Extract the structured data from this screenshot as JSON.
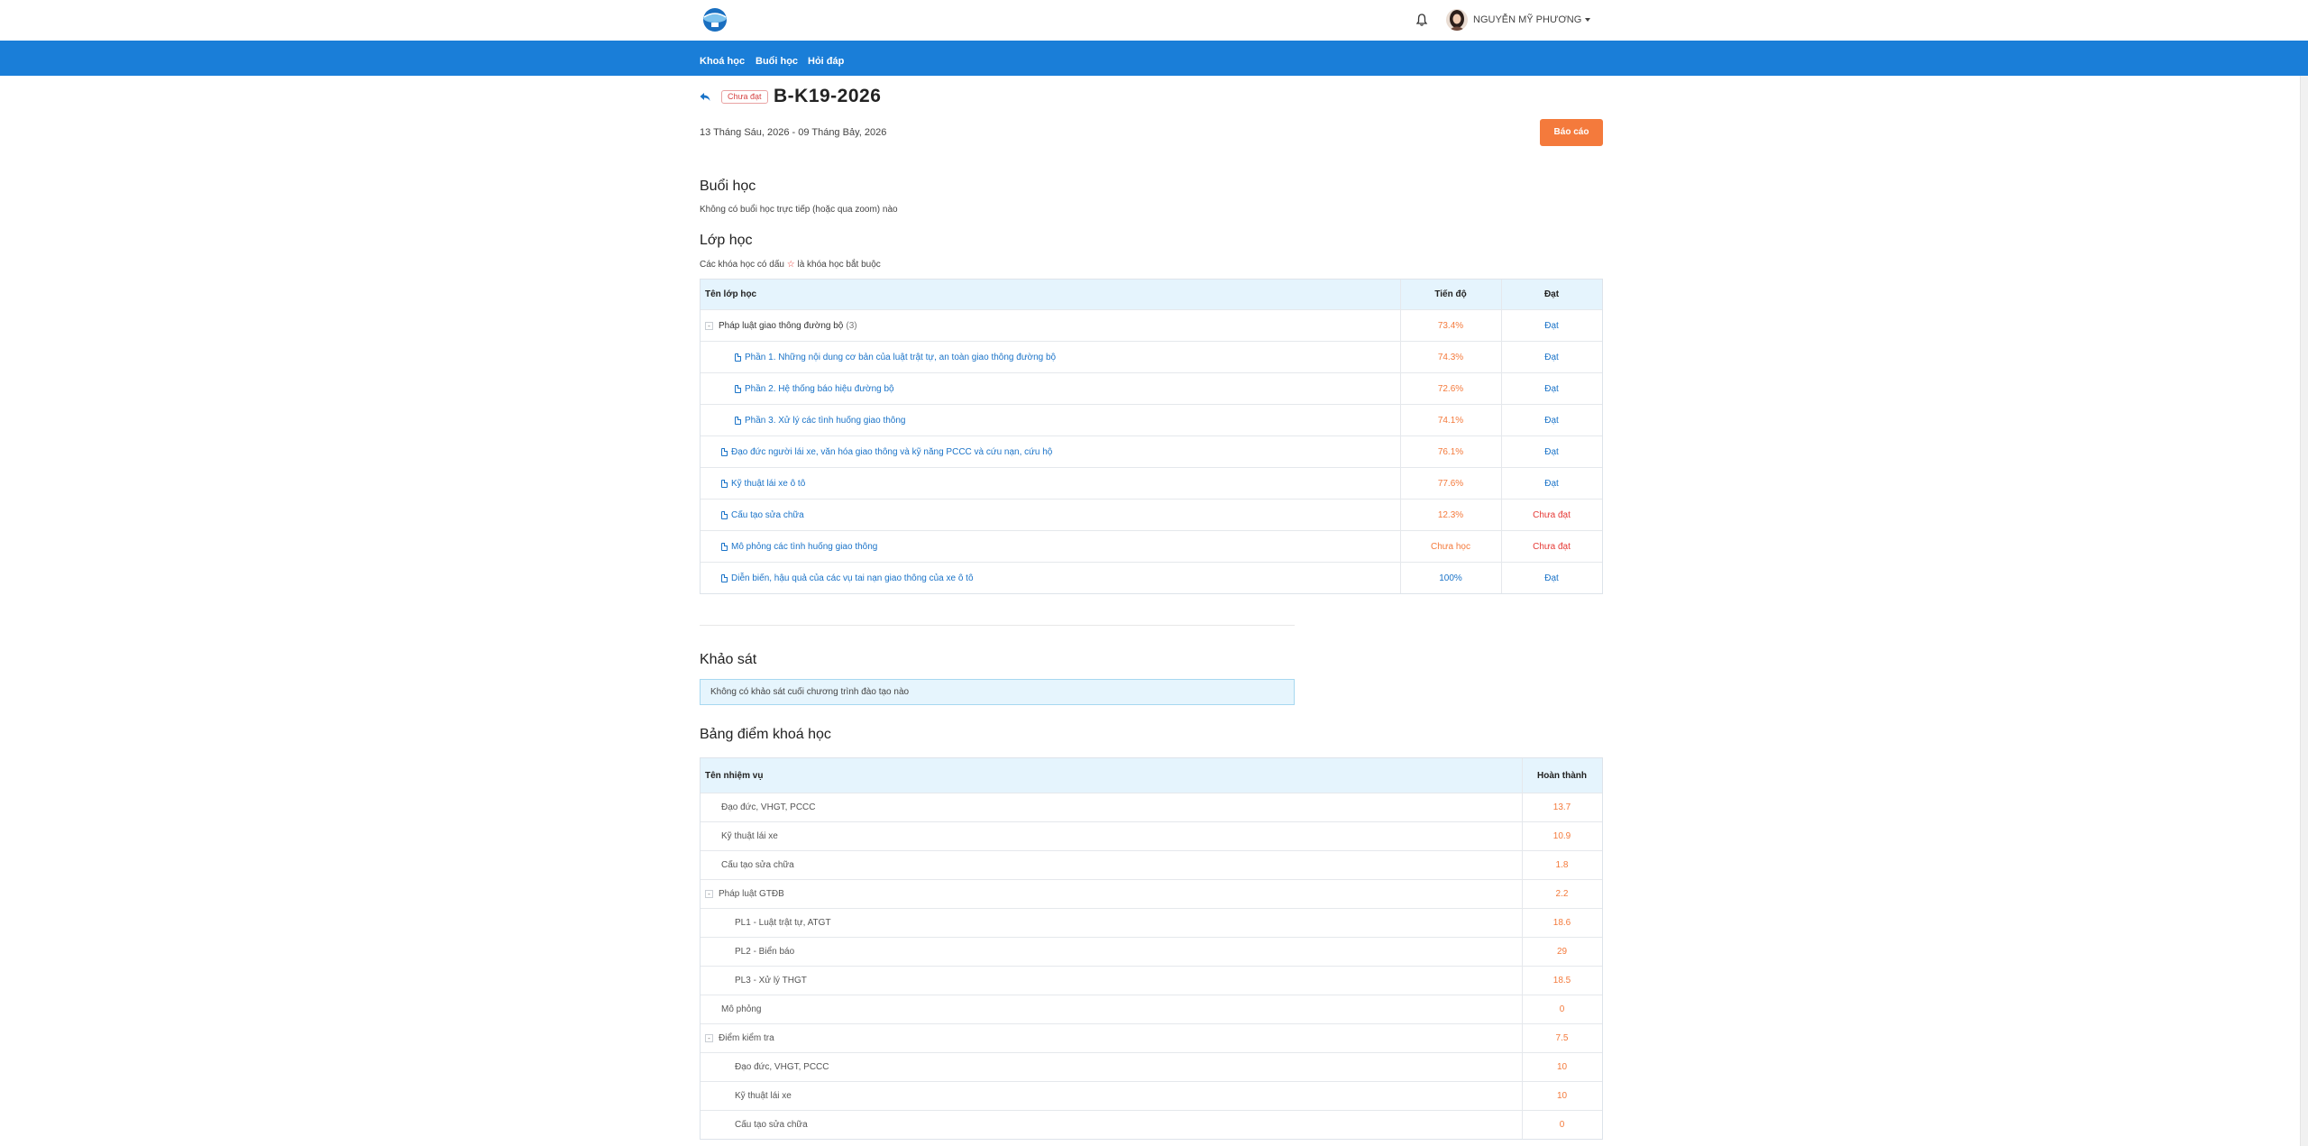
{
  "header": {
    "user_name": "NGUYỄN MỸ PHƯƠNG",
    "logo_icon": "school-logo-icon",
    "bell_icon": "bell-icon"
  },
  "nav": {
    "items": [
      "Khoá học",
      "Buổi học",
      "Hỏi đáp"
    ]
  },
  "course": {
    "status_badge": "Chưa đạt",
    "title": "B-K19-2026",
    "date_range": "13 Tháng Sáu, 2026 - 09 Tháng Bảy, 2026",
    "report_button": "Báo cáo"
  },
  "sessions": {
    "title": "Buổi học",
    "empty_text": "Không có buổi học trực tiếp (hoặc qua zoom) nào"
  },
  "classes": {
    "title": "Lớp học",
    "note_before": "Các khóa học có dấu",
    "note_star": "☆",
    "note_after": "là khóa học bắt buộc",
    "columns": [
      "Tên lớp học",
      "Tiến độ",
      "Đạt"
    ],
    "rows": [
      {
        "name": "Pháp luật giao thông đường bộ",
        "count": "(3)",
        "progress": "73.4%",
        "result": "Đạt",
        "level": 0,
        "group": true
      },
      {
        "name": "Phần 1. Những nội dung cơ bản của luật trật tự, an toàn giao thông đường bộ",
        "progress": "74.3%",
        "result": "Đạt",
        "level": 2
      },
      {
        "name": "Phần 2. Hệ thống báo hiệu đường bộ",
        "progress": "72.6%",
        "result": "Đạt",
        "level": 2
      },
      {
        "name": "Phần 3. Xử lý các tình huống giao thông",
        "progress": "74.1%",
        "result": "Đạt",
        "level": 2
      },
      {
        "name": "Đạo đức người lái xe, văn hóa giao thông và kỹ năng PCCC và cứu nạn, cứu hộ",
        "progress": "76.1%",
        "result": "Đạt",
        "level": 1
      },
      {
        "name": "Kỹ thuật lái xe ô tô",
        "progress": "77.6%",
        "result": "Đạt",
        "level": 1
      },
      {
        "name": "Cấu tạo sửa chữa",
        "progress": "12.3%",
        "result": "Chưa đạt",
        "level": 1
      },
      {
        "name": "Mô phỏng các tình huống giao thông",
        "progress": "Chưa học",
        "result": "Chưa đạt",
        "level": 1
      },
      {
        "name": "Diễn biến, hậu quả của các vụ tai nạn giao thông của xe ô tô",
        "progress": "100%",
        "result": "Đạt",
        "level": 1
      }
    ]
  },
  "survey": {
    "title": "Khảo sát",
    "empty_text": "Không có khảo sát cuối chương trình đào tạo nào"
  },
  "scores": {
    "title": "Bảng điểm khoá học",
    "columns": [
      "Tên nhiệm vụ",
      "Hoàn thành"
    ],
    "rows": [
      {
        "name": "Đạo đức, VHGT, PCCC",
        "value": "13.7",
        "level": 1
      },
      {
        "name": "Kỹ thuật lái xe",
        "value": "10.9",
        "level": 1
      },
      {
        "name": "Cấu tạo sửa chữa",
        "value": "1.8",
        "level": 1
      },
      {
        "name": "Pháp luật GTĐB",
        "value": "2.2",
        "level": 0,
        "group": true
      },
      {
        "name": "PL1 - Luật trật tự, ATGT",
        "value": "18.6",
        "level": 2
      },
      {
        "name": "PL2 - Biển báo",
        "value": "29",
        "level": 2
      },
      {
        "name": "PL3 - Xử lý THGT",
        "value": "18.5",
        "level": 2
      },
      {
        "name": "Mô phỏng",
        "value": "0",
        "level": 1
      },
      {
        "name": "Điểm kiểm tra",
        "value": "7.5",
        "level": 0,
        "group": true
      },
      {
        "name": "Đạo đức, VHGT, PCCC",
        "value": "10",
        "level": 2
      },
      {
        "name": "Kỹ thuật lái xe",
        "value": "10",
        "level": 2
      },
      {
        "name": "Cấu tạo sửa chữa",
        "value": "0",
        "level": 2
      }
    ]
  }
}
